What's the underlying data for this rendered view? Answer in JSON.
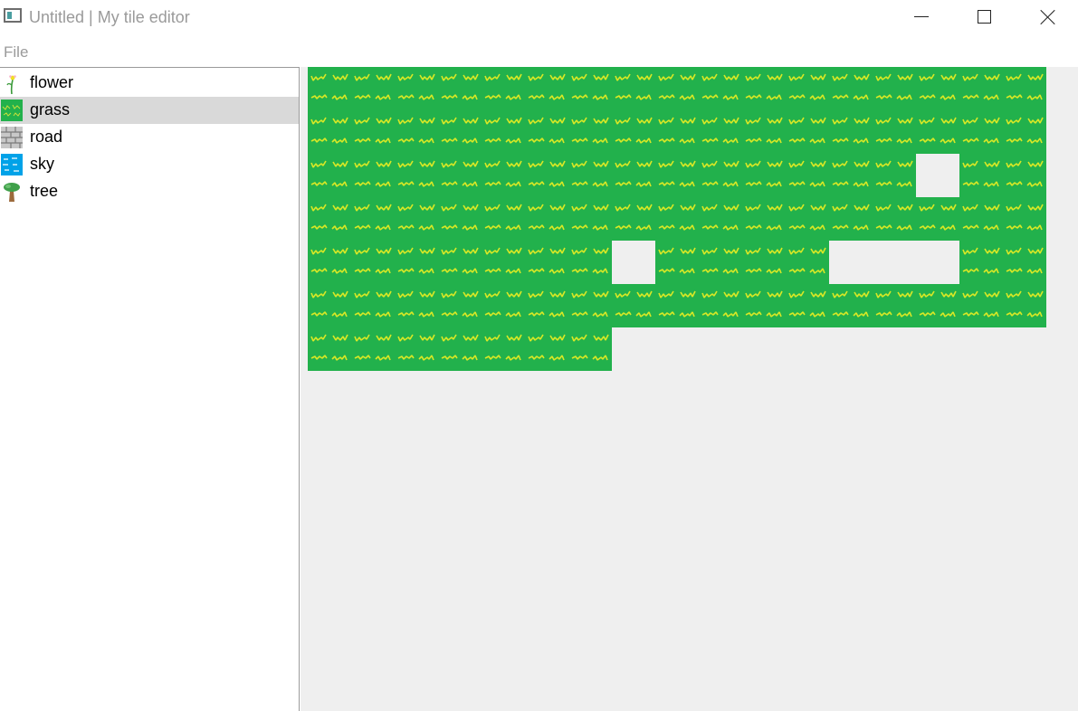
{
  "window": {
    "title": "Untitled | My tile editor",
    "controls": [
      "minimize-icon",
      "maximize-icon",
      "close-icon"
    ]
  },
  "menu": {
    "file_label": "File"
  },
  "colors": {
    "grass": "#22b14c",
    "grass_blade": "#e0e82a",
    "empty": "#efefef",
    "selected_row": "#d9d9d9"
  },
  "tiles": [
    {
      "label": "flower",
      "icon": "flower-icon",
      "selected": false
    },
    {
      "label": "grass",
      "icon": "grass-icon",
      "selected": true
    },
    {
      "label": "road",
      "icon": "road-icon",
      "selected": false
    },
    {
      "label": "sky",
      "icon": "sky-icon",
      "selected": false
    },
    {
      "label": "tree",
      "icon": "tree-icon",
      "selected": false
    }
  ],
  "map": {
    "columns": 17,
    "rows": 8,
    "rows_cells": [
      "11111111111111111",
      "11111111111111111",
      "11111111111111011",
      "11111111111111111",
      "11111110111100011",
      "11111111111111111",
      "1111111",
      ""
    ]
  }
}
